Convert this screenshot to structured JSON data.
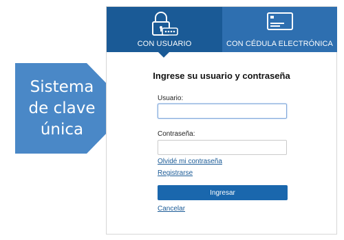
{
  "callout": {
    "line1": "Sistema",
    "line2": "de clave",
    "line3": "única"
  },
  "tabs": [
    {
      "label": "CON USUARIO",
      "icon": "lock-password-icon"
    },
    {
      "label": "CON CÉDULA ELECTRÓNICA",
      "icon": "id-card-icon"
    }
  ],
  "form": {
    "title": "Ingrese su usuario y contraseña",
    "user_label": "Usuario:",
    "user_value": "",
    "password_label": "Contraseña:",
    "password_value": "",
    "forgot_link": "Olvidé mi contraseña",
    "register_link": "Registrarse",
    "submit_label": "Ingresar",
    "cancel_link": "Cancelar"
  },
  "colors": {
    "callout": "#4a88c7",
    "tab_active": "#1a5a96",
    "tab_inactive": "#2e6fb0",
    "button": "#1a67ad"
  }
}
